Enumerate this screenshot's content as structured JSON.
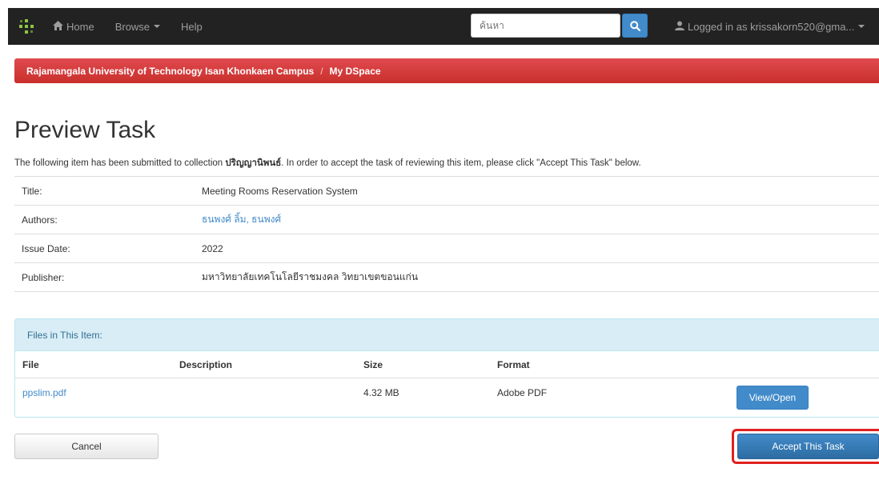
{
  "navbar": {
    "logo_icon": "dspace-logo-icon",
    "home_label": "Home",
    "browse_label": "Browse",
    "help_label": "Help",
    "search_placeholder": "ค้นหา",
    "user_label": "Logged in as krissakorn520@gma..."
  },
  "breadcrumb": {
    "items": [
      "Rajamangala University of Technology Isan Khonkaen Campus",
      "My DSpace"
    ]
  },
  "page": {
    "title": "Preview Task",
    "intro_before": "The following item has been submitted to collection ",
    "collection": "ปริญญานิพนธ์",
    "intro_after": ". In order to accept the task of reviewing this item, please click \"Accept This Task\" below."
  },
  "metadata": [
    {
      "key": "Title:",
      "value": "Meeting Rooms Reservation System"
    },
    {
      "key": "Authors:",
      "value": "ธนพงศ์ ลิ้ม, ธนพงศ์"
    },
    {
      "key": "Issue Date:",
      "value": "2022"
    },
    {
      "key": "Publisher:",
      "value": "มหาวิทยาลัยเทคโนโลยีราชมงคล วิทยาเขตขอนแก่น"
    }
  ],
  "files": {
    "heading": "Files in This Item:",
    "columns": [
      "File",
      "Description",
      "Size",
      "Format"
    ],
    "rows": [
      {
        "file": "ppslim.pdf",
        "description": "",
        "size": "4.32 MB",
        "format": "Adobe PDF",
        "action": "View/Open"
      }
    ]
  },
  "actions": {
    "cancel_label": "Cancel",
    "accept_label": "Accept This Task"
  },
  "colors": {
    "navbar": "#222222",
    "breadcrumb": "#d9353a",
    "primary": "#428bca",
    "highlight": "#e02020"
  }
}
